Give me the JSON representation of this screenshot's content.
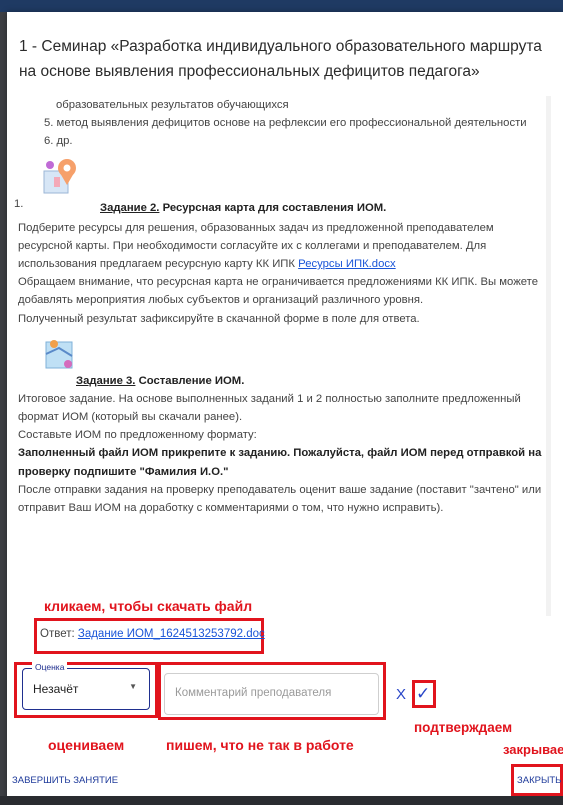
{
  "dialog": {
    "title": "1 - Семинар «Разработка индивидуального образовательного маршрута на основе выявления профессиональных дефицитов педагога»"
  },
  "content": {
    "list_continuation": "образовательных результатов обучающихся",
    "list_item_5": "5. метод выявления дефицитов основе на рефлексии его профессиональной деятельности",
    "list_item_6": "6. др.",
    "list_number_1": "1.",
    "task2": {
      "heading_prefix": "Задание 2.",
      "heading_rest": " Ресурсная карта для составления ИОМ.",
      "text_1": "Подберите ресурсы для решения, образованных задач из предложенной преподавателем ресурсной карты. При необходимости согласуйте их с коллегами и преподавателем. Для использования предлагаем ресурсную карту КК ИПК ",
      "link": "Ресурсы ИПК.docx",
      "text_2": "Обращаем внимание, что ресурсная карта не ограничивается предложениями КК ИПК. Вы можете добавлять мероприятия любых субъектов и организаций различного уровня.",
      "text_3": "Полученный результат зафиксируйте в скачанной форме в поле для ответа."
    },
    "task3": {
      "heading_prefix": "Задание 3.",
      "heading_rest": " Составление ИОМ.",
      "text_1": "Итоговое задание. На основе выполненных заданий 1 и 2 полностью заполните предложенный формат ИОМ (который вы скачали ранее).",
      "text_2": "Составьте ИОМ по предложенному формату:",
      "text_bold": "Заполненный файл ИОМ прикрепите к заданию. Пожалуйста, файл ИОМ перед отправкой на проверку подпишите \"Фамилия И.О.\"",
      "text_3": "После отправки задания на проверку преподаватель оценит ваше задание (поставит \"зачтено\" или отправит Ваш ИОМ на доработку с комментариями о том, что нужно исправить)."
    }
  },
  "answer": {
    "label": "Ответ: ",
    "file_link": "Задание ИОМ_1624513253792.doc"
  },
  "grading": {
    "grade_label": "Оценка",
    "grade_value": "Незачёт",
    "comment_placeholder": "Комментарий преподавателя",
    "cancel_symbol": "X",
    "confirm_symbol": "✓"
  },
  "footer": {
    "finish_button": "ЗАВЕРШИТЬ ЗАНЯТИЕ",
    "close_button": "ЗАКРЫТЬ"
  },
  "annotations": {
    "download_hint": "кликаем, чтобы скачать файл",
    "grade_hint": "оцениваем",
    "comment_hint": "пишем, что не так в работе",
    "confirm_hint": "подтверждаем",
    "close_hint": "закрываем"
  },
  "colors": {
    "annotation_red": "#e1141d",
    "accent_blue": "#2946c8",
    "link_blue": "#1a55d8"
  },
  "icons": {
    "task2_icon": "map-pin-illustration-icon",
    "task3_icon": "map-illustration-icon",
    "dropdown": "chevron-down-icon",
    "cancel": "close-icon",
    "confirm": "check-icon"
  }
}
